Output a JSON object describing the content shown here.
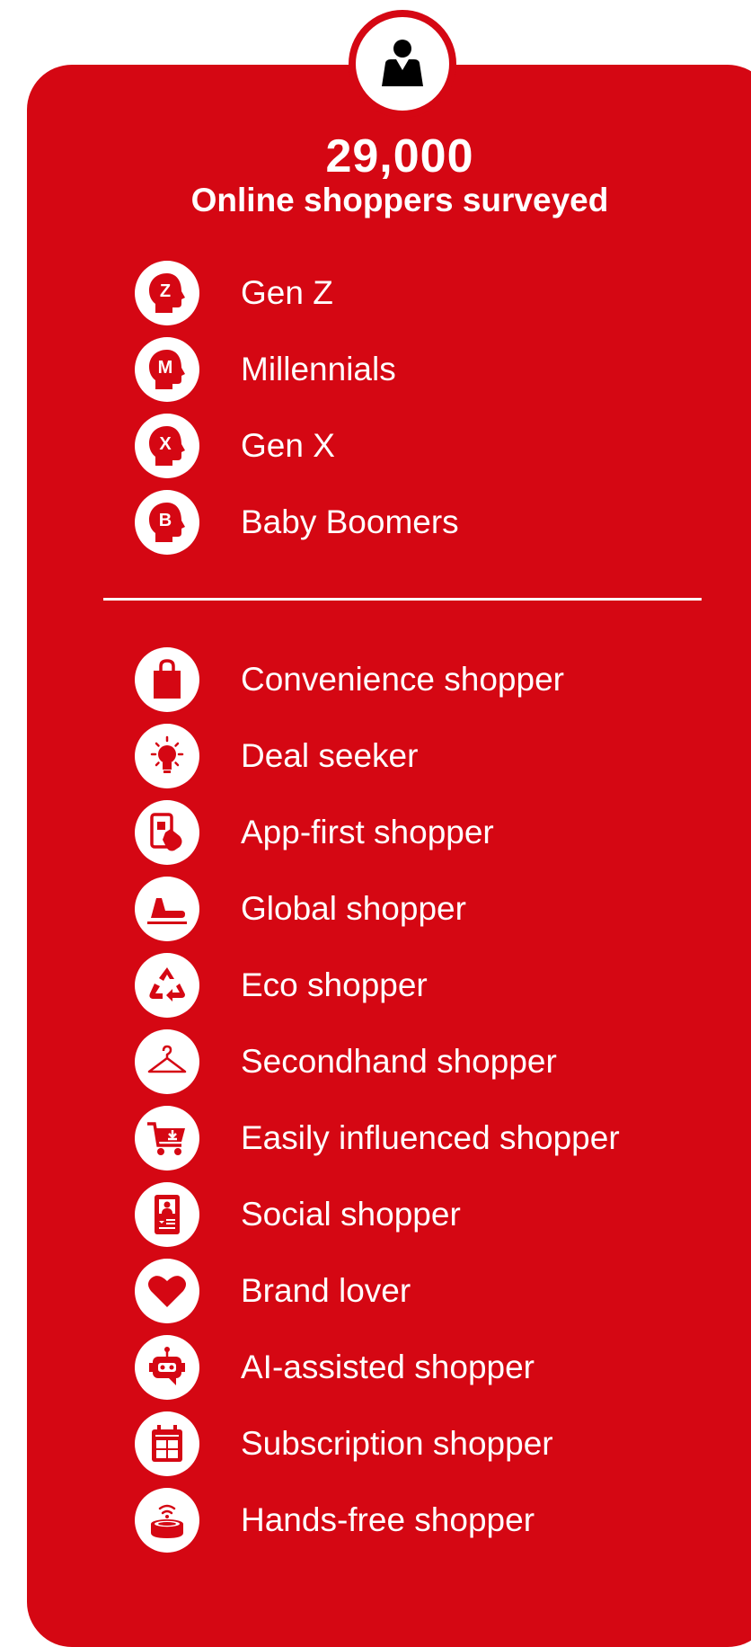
{
  "header": {
    "icon": "person-icon",
    "stat_number": "29,000",
    "stat_label": "Online shoppers surveyed"
  },
  "generations": [
    {
      "icon": "gen-z-head-icon",
      "letter": "Z",
      "label": "Gen Z"
    },
    {
      "icon": "millennials-head-icon",
      "letter": "M",
      "label": "Millennials"
    },
    {
      "icon": "gen-x-head-icon",
      "letter": "X",
      "label": "Gen X"
    },
    {
      "icon": "baby-boomers-head-icon",
      "letter": "B",
      "label": "Baby Boomers"
    }
  ],
  "shopper_types": [
    {
      "icon": "shopping-bag-icon",
      "label": "Convenience shopper"
    },
    {
      "icon": "lightbulb-icon",
      "label": "Deal seeker"
    },
    {
      "icon": "phone-tap-icon",
      "label": "App-first shopper"
    },
    {
      "icon": "airplane-icon",
      "label": "Global shopper"
    },
    {
      "icon": "recycle-icon",
      "label": "Eco shopper"
    },
    {
      "icon": "hanger-icon",
      "label": "Secondhand shopper"
    },
    {
      "icon": "cart-icon",
      "label": "Easily influenced shopper"
    },
    {
      "icon": "social-profile-icon",
      "label": "Social shopper"
    },
    {
      "icon": "heart-icon",
      "label": "Brand lover"
    },
    {
      "icon": "robot-icon",
      "label": "AI-assisted shopper"
    },
    {
      "icon": "calendar-icon",
      "label": "Subscription shopper"
    },
    {
      "icon": "smart-speaker-icon",
      "label": "Hands-free shopper"
    }
  ],
  "colors": {
    "brand_red": "#d50713",
    "white": "#ffffff"
  }
}
